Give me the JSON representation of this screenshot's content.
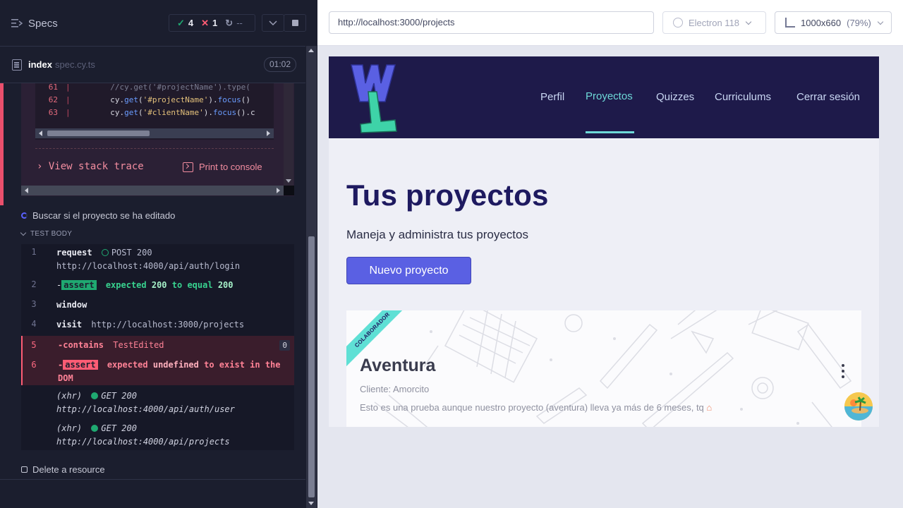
{
  "reporter": {
    "title": "Specs",
    "stats": {
      "passed": "4",
      "failed": "1",
      "pending": "--"
    },
    "spec": {
      "name": "index",
      "ext": "spec.cy.ts",
      "duration": "01:02"
    },
    "code_lines": [
      {
        "num": "61",
        "text": "//cy.get('#projectName').type("
      },
      {
        "num": "62",
        "fn": "get",
        "str": "'#projectName'",
        "fn2": "focus",
        "tail": "()"
      },
      {
        "num": "63",
        "fn": "get",
        "str": "'#clientName'",
        "fn2": "focus",
        "tail": "().c"
      }
    ],
    "stack_trace": "View stack trace",
    "print_console": "Print to console",
    "test_title": "Buscar si el proyecto se ha editado",
    "test_body_label": "TEST BODY",
    "commands": [
      {
        "num": "1",
        "name": "request",
        "status": "POST 200",
        "url": "http://localhost:4000/api/auth/login"
      },
      {
        "num": "2",
        "prefix": "-",
        "name": "assert",
        "w1": "expected",
        "v1": "200",
        "w2": "to equal",
        "v2": "200"
      },
      {
        "num": "3",
        "name": "window"
      },
      {
        "num": "4",
        "name": "visit",
        "msg": "http://localhost:3000/projects"
      },
      {
        "num": "5",
        "prefix": "-",
        "name": "contains",
        "msg": "TestEdited",
        "badge": "0"
      },
      {
        "num": "6",
        "prefix": "-",
        "name": "assert",
        "w1": "expected",
        "v1": "undefined",
        "w2": "to exist in the",
        "v2": "DOM"
      },
      {
        "kind": "(xhr)",
        "status": "GET 200",
        "url": "http://localhost:4000/api/auth/user"
      },
      {
        "kind": "(xhr)",
        "status": "GET 200",
        "url": "http://localhost:4000/api/projects"
      }
    ],
    "next_test": "Delete a resource"
  },
  "aut": {
    "url": "http://localhost:3000/projects",
    "browser": "Electron 118",
    "viewport": "1000x660",
    "scale": "(79%)"
  },
  "app": {
    "nav": [
      "Perfil",
      "Proyectos",
      "Quizzes",
      "Curriculums",
      "Cerrar sesión"
    ],
    "active_nav": "Proyectos",
    "title": "Tus proyectos",
    "subtitle": "Maneja y administra tus proyectos",
    "new_button": "Nuevo proyecto",
    "card": {
      "ribbon": "COLABORADOR",
      "title": "Aventura",
      "client": "Cliente: Amorcito",
      "description": "Esto es una prueba aunque nuestro proyecto (aventura) lleva ya más de 6 meses, tq"
    }
  },
  "colors": {
    "reporter_bg": "#1b1e2e",
    "pass": "#1fa971",
    "fail": "#ff5c74",
    "nav_bg": "#1e1a4a",
    "accent": "#6ed9d8",
    "primary_button": "#5a60e3",
    "title": "#1e1a60"
  }
}
